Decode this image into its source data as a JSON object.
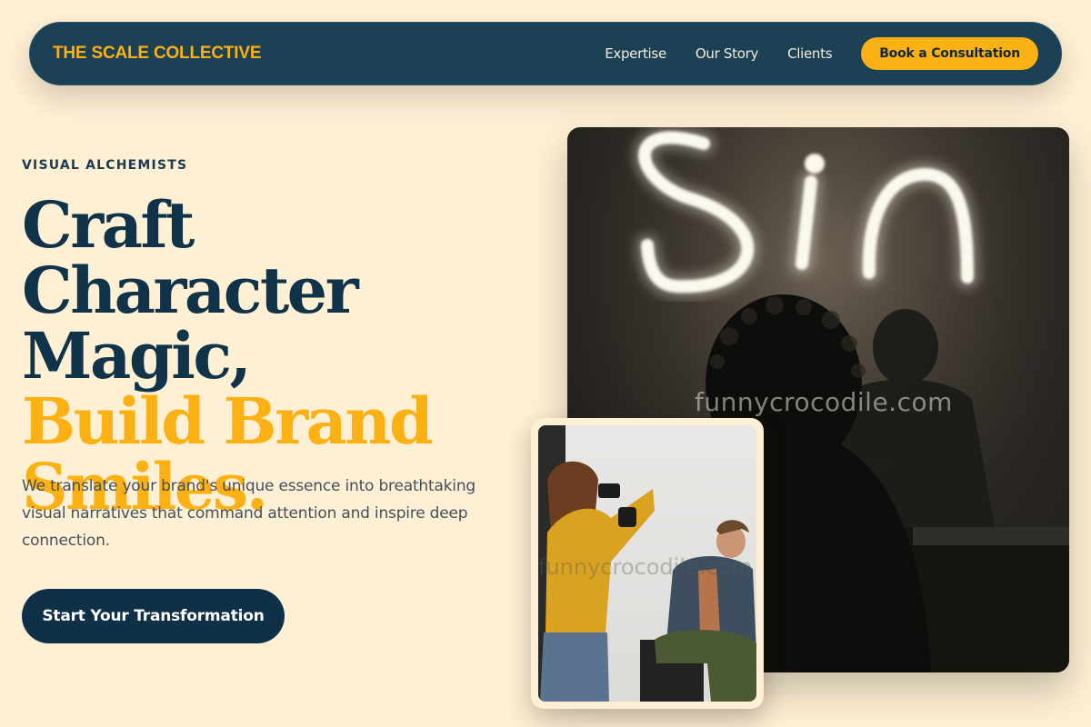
{
  "nav": {
    "logo": "THE SCALE COLLECTIVE",
    "links": [
      "Expertise",
      "Our Story",
      "Clients"
    ],
    "cta": "Book a Consultation"
  },
  "hero": {
    "eyebrow": "VISUAL ALCHEMISTS",
    "headline_dark": [
      "Craft Character",
      "Magic,"
    ],
    "headline_gold": [
      "Build Brand",
      "Smiles."
    ],
    "lede": "We translate your brand's unique essence into breathtaking visual narratives that command attention and inspire deep connection.",
    "cta": "Start Your Transformation"
  },
  "images": {
    "main": {
      "neon_text": "Sin",
      "watermark": "funnycrocodile.com"
    },
    "secondary": {
      "watermark": "funnycrocodile.com"
    }
  },
  "colors": {
    "background": "#fdf0d5",
    "navy": "#1c4155",
    "navy_dark": "#0f3047",
    "gold": "#fbb114"
  }
}
